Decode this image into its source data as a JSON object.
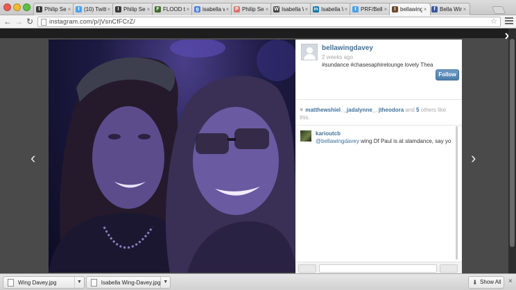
{
  "browser": {
    "tabs": [
      {
        "label": "Philip Se",
        "favicon": "instagram-icon",
        "color": "#3a3a3a",
        "glyph": "I",
        "active": false
      },
      {
        "label": "(10) Twitt",
        "favicon": "twitter-icon",
        "color": "#4aa1eb",
        "glyph": "t",
        "active": false
      },
      {
        "label": "Philip Se",
        "favicon": "instagram-icon",
        "color": "#3a3a3a",
        "glyph": "I",
        "active": false
      },
      {
        "label": "FLOOD th",
        "favicon": "flood-icon",
        "color": "#3c6b2a",
        "glyph": "F",
        "active": false
      },
      {
        "label": "isabella w",
        "favicon": "google-icon",
        "color": "#4a7fe0",
        "glyph": "g",
        "active": false
      },
      {
        "label": "Philip Se",
        "favicon": "generic-icon",
        "color": "#e0716b",
        "glyph": "P",
        "active": false
      },
      {
        "label": "Isabella W",
        "favicon": "imdb-icon",
        "color": "#444444",
        "glyph": "W",
        "active": false
      },
      {
        "label": "Isabella W",
        "favicon": "linkedin-icon",
        "color": "#0e76a8",
        "glyph": "in",
        "active": false
      },
      {
        "label": "PRF/Bella",
        "favicon": "twitter-icon",
        "color": "#4aa1eb",
        "glyph": "t",
        "active": false
      },
      {
        "label": "bellawing",
        "favicon": "instagram-icon",
        "color": "#6b4a2f",
        "glyph": "I",
        "active": true
      },
      {
        "label": "Bella Wing",
        "favicon": "facebook-icon",
        "color": "#3b5998",
        "glyph": "f",
        "active": false
      }
    ],
    "tab_close": "×",
    "url": "instagram.com/p/jVsnCfFCrZ/",
    "nav": {
      "back": "←",
      "forward": "→",
      "reload": "↻"
    },
    "star": "☆"
  },
  "overlay": {
    "prev_arrow": "‹",
    "next_arrow": "›",
    "close": "✕"
  },
  "post": {
    "username": "bellawingdavey",
    "time": "2 weeks ago",
    "caption": "#sundance #chasesaphirelounge lovely Thea",
    "follow_label": "Follow",
    "likes": {
      "likers": [
        "matthewshiel",
        "_jadalynne_",
        "jtheodora"
      ],
      "sep1": ", ",
      "sep2": ", ",
      "and": " and ",
      "count": "5",
      "suffix": " others like this."
    },
    "comments": [
      {
        "user": "karioutcb",
        "mention": "@bellawingdavey",
        "text": " wing Df Paul is at slamdance, say yo"
      }
    ]
  },
  "downloads": {
    "items": [
      {
        "name": "Wing Davey.jpg"
      },
      {
        "name": "Isabella Wing-Davey.jpg"
      }
    ],
    "show_all": "Show All",
    "close": "×"
  },
  "colors": {
    "link": "#3f729b",
    "follow": "#4c7fad"
  }
}
